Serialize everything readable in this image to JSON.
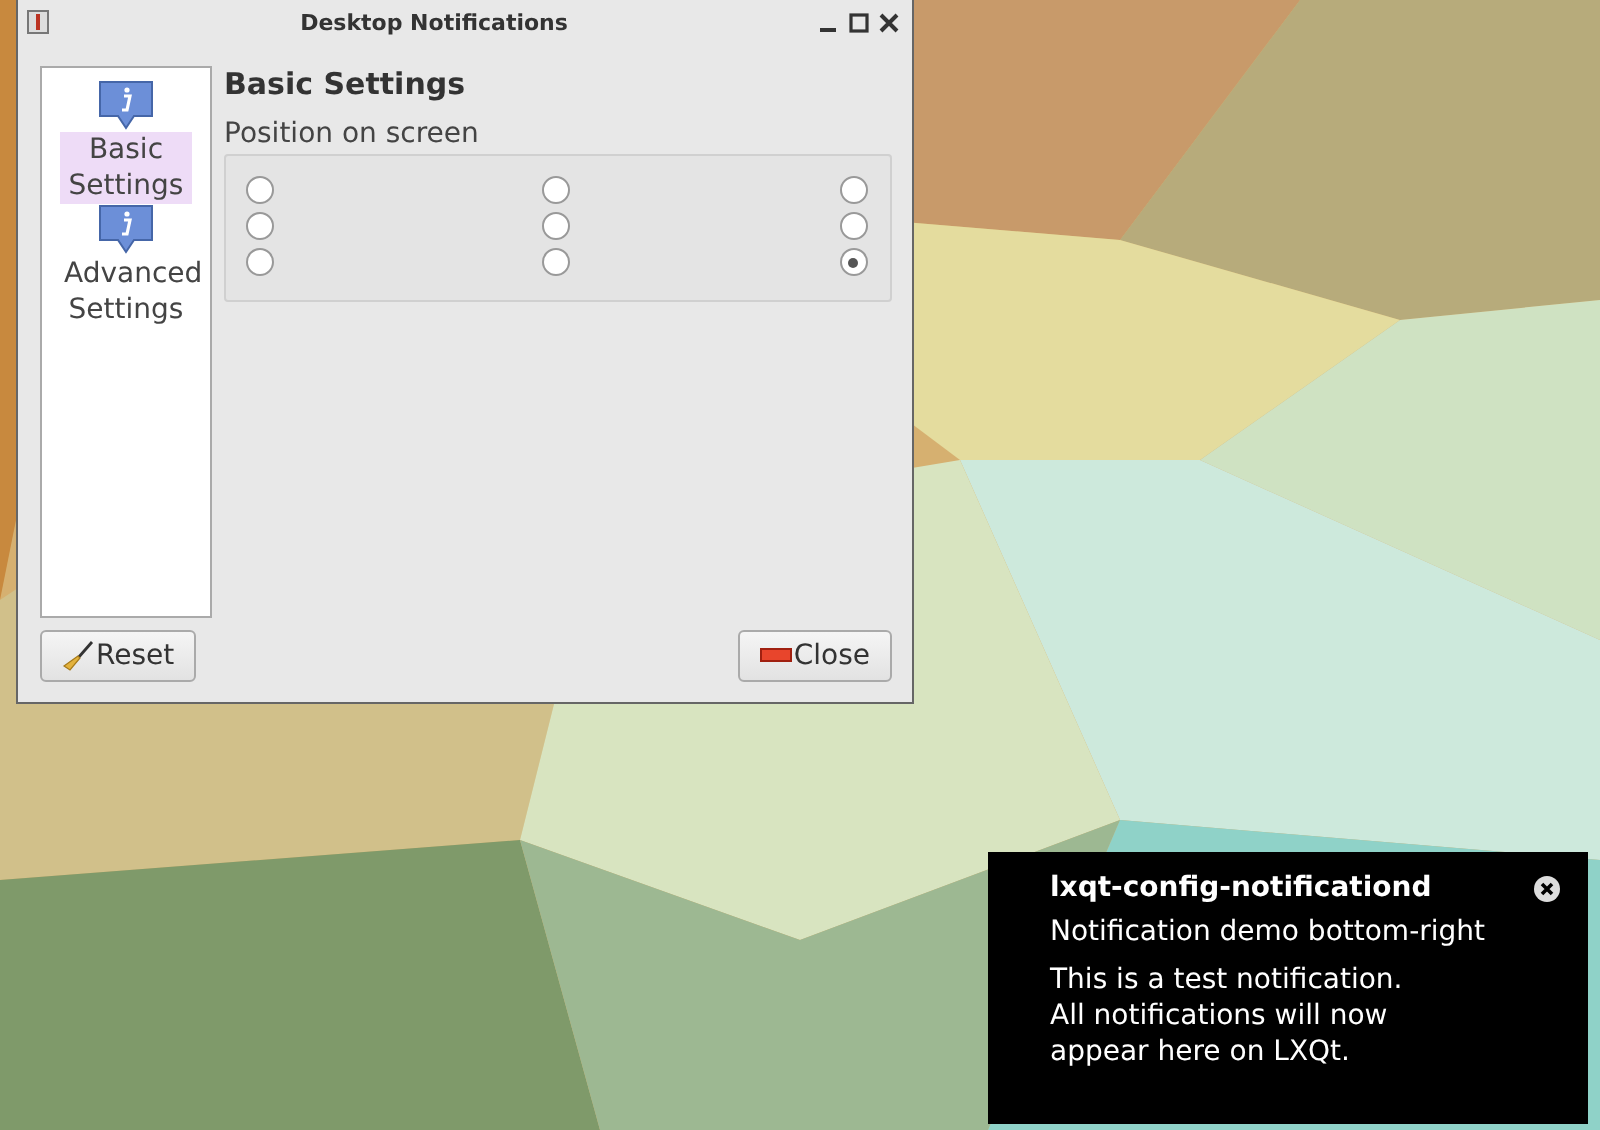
{
  "window": {
    "title": "Desktop Notifications"
  },
  "sidebar": {
    "items": [
      {
        "label": "Basic Settings",
        "selected": true
      },
      {
        "label": "Advanced Settings",
        "selected": false
      }
    ]
  },
  "page": {
    "heading": "Basic Settings",
    "group_label": "Position on screen",
    "positions": [
      {
        "selected": false
      },
      {
        "selected": false
      },
      {
        "selected": false
      },
      {
        "selected": false
      },
      {
        "selected": false
      },
      {
        "selected": false
      },
      {
        "selected": false
      },
      {
        "selected": false
      },
      {
        "selected": true
      }
    ]
  },
  "buttons": {
    "reset": "Reset",
    "close": "Close"
  },
  "notification": {
    "app": "lxqt-config-notificationd",
    "summary": "Notification demo bottom-right",
    "body": "This is a test notification. All notifications will now appear here on LXQt."
  }
}
